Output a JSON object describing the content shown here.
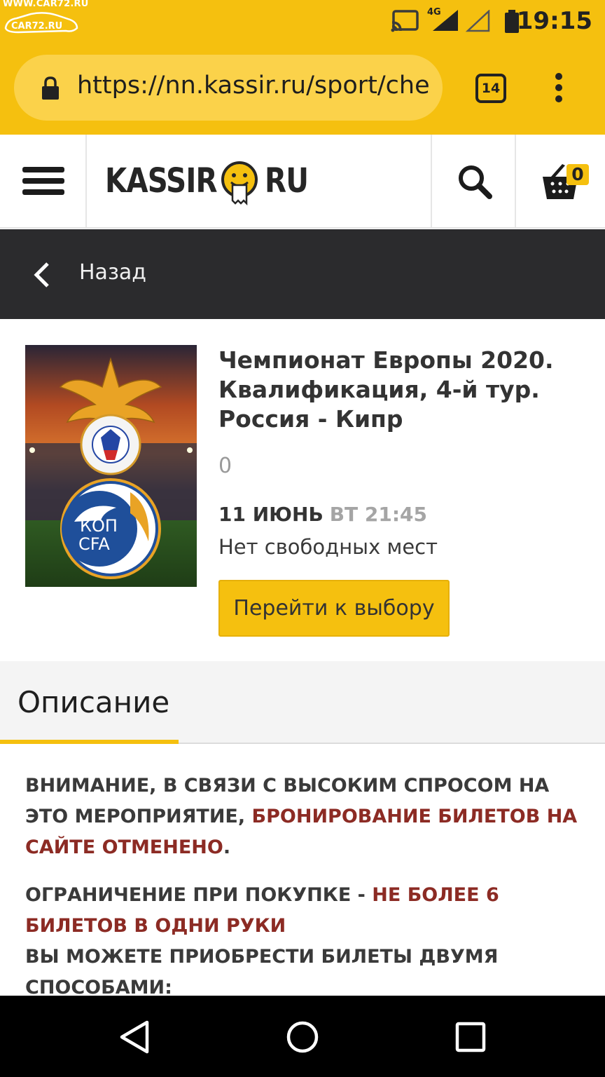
{
  "watermark": {
    "url": "WWW.CAR72.RU",
    "logo_text": "CAR72.RU"
  },
  "status_bar": {
    "network": "4G",
    "time": "19:15"
  },
  "browser": {
    "url": "https://nn.kassir.ru/sport/che",
    "tab_count": "14"
  },
  "site": {
    "logo_left": "KASSIR",
    "logo_right": "RU",
    "cart_count": "0",
    "colors": {
      "brand_yellow": "#f5c00f",
      "dark_bar": "#2b2b2d",
      "alert_red": "#8c2b24"
    }
  },
  "backbar": {
    "label": "Назад"
  },
  "event": {
    "title": "Чемпионат Европы 2020. Квалификация, 4-й тур. Россия - Кипр",
    "price": "0",
    "date": "11 ИЮНЬ",
    "weekday_time": "ВТ 21:45",
    "availability": "Нет свободных мест",
    "select_button": "Перейти к выбору",
    "poster_badge": {
      "line1": "КОП",
      "line2": "CFA"
    }
  },
  "description": {
    "tab_label": "Описание",
    "p1_a": "ВНИМАНИЕ, В СВЯЗИ С ВЫСОКИМ СПРОСОМ НА ЭТО МЕРОПРИЯТИЕ, ",
    "p1_b": "БРОНИРОВАНИЕ БИЛЕТОВ НА САЙТЕ ОТМЕНЕНО",
    "p1_c": ".",
    "p2_a": "ОГРАНИЧЕНИЕ ПРИ ПОКУПКЕ - ",
    "p2_b": "НЕ БОЛЕЕ 6 БИЛЕТОВ В ОДНИ РУКИ",
    "p3": "ВЫ МОЖЕТЕ ПРИОБРЕСТИ БИЛЕТЫ ДВУМЯ СПОСОБАМИ:"
  }
}
